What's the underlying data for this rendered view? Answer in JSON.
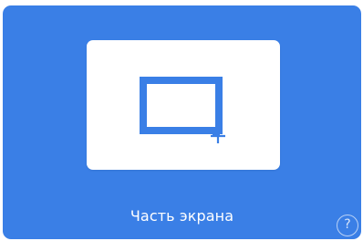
{
  "tile": {
    "label": "Часть экрана",
    "help_glyph": "?",
    "icon": "rectangle-snip-icon",
    "accent_color": "#3a7fe6"
  }
}
